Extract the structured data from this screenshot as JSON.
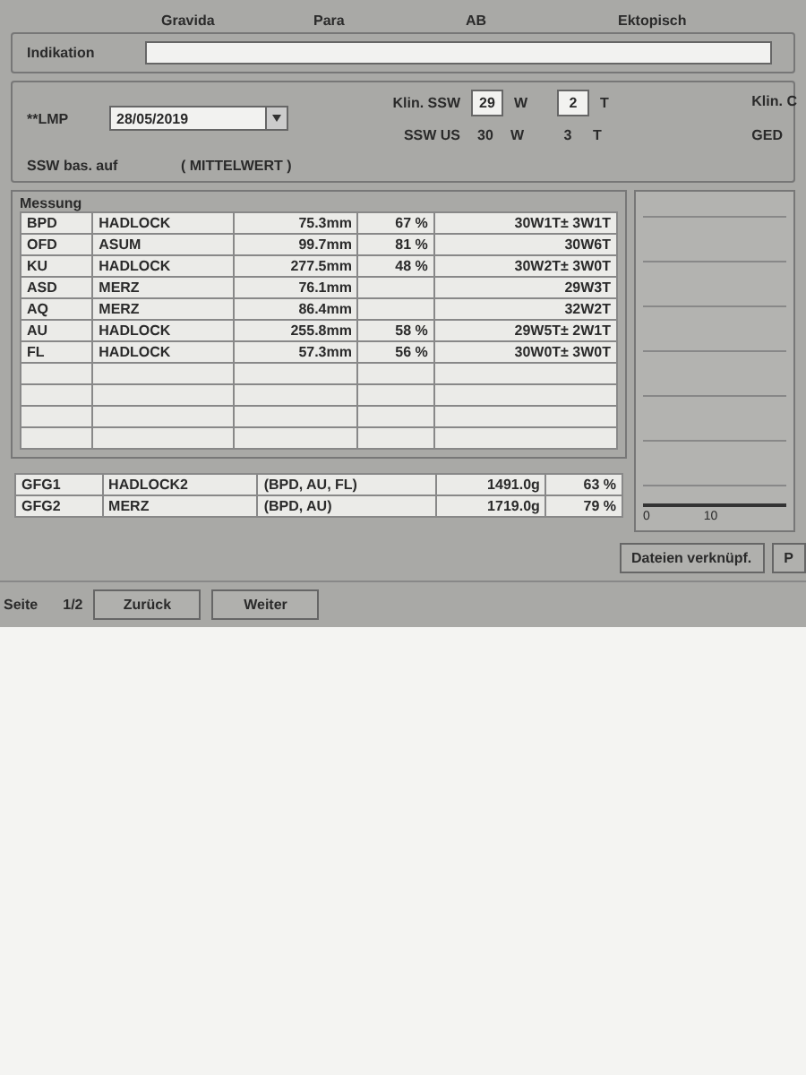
{
  "header_labels": [
    "Gravida",
    "Para",
    "AB",
    "Ektopisch"
  ],
  "indikation": {
    "label": "Indikation"
  },
  "lmp": {
    "label": "**LMP",
    "value": "28/05/2019"
  },
  "ssw": [
    {
      "label": "Klin. SSW",
      "weeks": "29",
      "w": "W",
      "days": "2",
      "t": "T",
      "kind": "input"
    },
    {
      "label": "SSW US",
      "weeks": "30",
      "w": "W",
      "days": "3",
      "t": "T",
      "kind": "text"
    }
  ],
  "right_labels": [
    "Klin. C",
    "GED"
  ],
  "ssw_basis": {
    "label": "SSW bas. auf",
    "value": "( MITTELWERT )"
  },
  "measurements": {
    "title": "Messung",
    "rows": [
      {
        "name": "BPD",
        "method": "HADLOCK",
        "value": "75.3mm",
        "percentile": "67 %",
        "ga": "30W1T± 3W1T"
      },
      {
        "name": "OFD",
        "method": "ASUM",
        "value": "99.7mm",
        "percentile": "81 %",
        "ga": "30W6T"
      },
      {
        "name": "KU",
        "method": "HADLOCK",
        "value": "277.5mm",
        "percentile": "48 %",
        "ga": "30W2T± 3W0T"
      },
      {
        "name": "ASD",
        "method": "MERZ",
        "value": "76.1mm",
        "percentile": "",
        "ga": "29W3T"
      },
      {
        "name": "AQ",
        "method": "MERZ",
        "value": "86.4mm",
        "percentile": "",
        "ga": "32W2T"
      },
      {
        "name": "AU",
        "method": "HADLOCK",
        "value": "255.8mm",
        "percentile": "58 %",
        "ga": "29W5T± 2W1T"
      },
      {
        "name": "FL",
        "method": "HADLOCK",
        "value": "57.3mm",
        "percentile": "56 %",
        "ga": "30W0T± 3W0T"
      }
    ]
  },
  "weights": [
    {
      "id": "GFG1",
      "method": "HADLOCK2",
      "params": "(BPD, AU, FL)",
      "weight": "1491.0g",
      "percent": "63 %"
    },
    {
      "id": "GFG2",
      "method": "MERZ",
      "params": "(BPD, AU)",
      "weight": "1719.0g",
      "percent": "79 %"
    }
  ],
  "chart_ticks": [
    "0",
    "10"
  ],
  "buttons": [
    "Dateien verknüpf.",
    "P"
  ],
  "footer": {
    "label": "Seite",
    "page": "1/2",
    "buttons": [
      "Zurück",
      "Weiter"
    ]
  }
}
